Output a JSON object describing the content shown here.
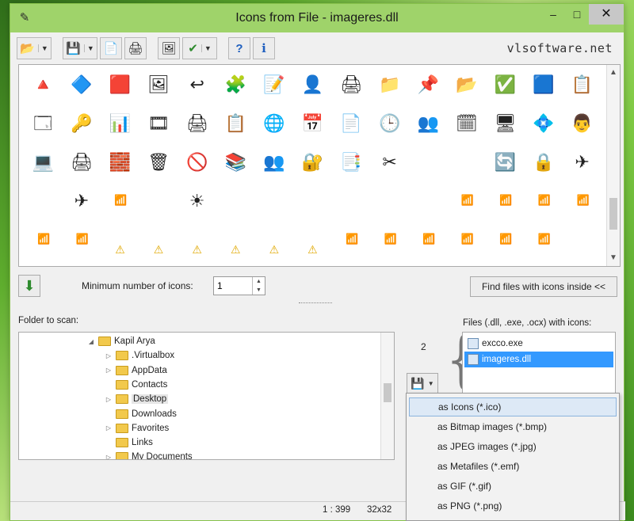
{
  "window": {
    "title": "Icons from File - imageres.dll",
    "app_icon": "pencil-icon",
    "controls": {
      "minimize": "–",
      "maximize": "□",
      "close": "✕"
    }
  },
  "toolbar": {
    "brand": "vlsoftware.net",
    "buttons": [
      {
        "name": "open-folder-icon",
        "glyph": "📂",
        "dropdown": true
      },
      {
        "name": "save-disk-icon",
        "glyph": "💾",
        "dropdown": true
      },
      {
        "name": "copy-icon",
        "glyph": "📄"
      },
      {
        "name": "print-icon",
        "glyph": "🖨"
      },
      {
        "name": "image-preview-icon",
        "glyph": "🖼"
      },
      {
        "name": "select-checkmark-icon",
        "glyph": "✔",
        "dropdown": true
      },
      {
        "name": "help-icon",
        "glyph": "?"
      },
      {
        "name": "info-icon",
        "glyph": "i"
      }
    ]
  },
  "icon_grid": {
    "rows": [
      [
        "🔺",
        "🔷",
        "🟥",
        "🖼",
        "↩",
        "🧩",
        "📝",
        "👤",
        "🖨",
        "📁",
        "📌",
        "📂",
        "✅",
        "🟦",
        "📋"
      ],
      [
        "🗔",
        "🔑",
        "📊",
        "🎞",
        "🖨",
        "📋",
        "🌐",
        "📅",
        "📄",
        "🕒",
        "👥",
        "🗓",
        "🖥",
        "💠",
        "👨"
      ],
      [
        "💻",
        "🖨",
        "🧱",
        "🗑",
        "🚫",
        "📚",
        "👥",
        "🔐",
        "📑",
        "✂",
        "",
        "",
        "🔄",
        "🔒",
        "✈"
      ],
      [
        "",
        "✈",
        "📶",
        "",
        "☀",
        "",
        "",
        "",
        "",
        "",
        "",
        "📶",
        "📶",
        "📶",
        "📶"
      ],
      [
        "📶",
        "📶",
        "⚠",
        "⚠",
        "⚠",
        "⚠",
        "⚠",
        "⚠",
        "📶",
        "📶",
        "📶",
        "📶",
        "📶",
        "📶",
        ""
      ]
    ]
  },
  "controls": {
    "min_icons_label": "Minimum number of icons:",
    "min_icons_value": "1",
    "find_button": "Find files with icons inside <<"
  },
  "folder_panel": {
    "label": "Folder to scan:",
    "items": [
      {
        "label": "Kapil Arya",
        "expander": "◢",
        "indent": 0,
        "selected": false
      },
      {
        "label": ".Virtualbox",
        "expander": "▷",
        "indent": 1,
        "selected": false
      },
      {
        "label": "AppData",
        "expander": "▷",
        "indent": 1,
        "selected": false
      },
      {
        "label": "Contacts",
        "expander": "",
        "indent": 1,
        "selected": false
      },
      {
        "label": "Desktop",
        "expander": "▷",
        "indent": 1,
        "selected": true
      },
      {
        "label": "Downloads",
        "expander": "",
        "indent": 1,
        "selected": false
      },
      {
        "label": "Favorites",
        "expander": "▷",
        "indent": 1,
        "selected": false
      },
      {
        "label": "Links",
        "expander": "",
        "indent": 1,
        "selected": false
      },
      {
        "label": "My Documents",
        "expander": "▷",
        "indent": 1,
        "selected": false
      }
    ]
  },
  "files_panel": {
    "count": "2",
    "label": "Files (.dll, .exe, .ocx) with icons:",
    "items": [
      {
        "label": "excco.exe",
        "selected": false
      },
      {
        "label": "imageres.dll",
        "selected": true
      }
    ]
  },
  "save_menu": {
    "items": [
      "as Icons (*.ico)",
      "as Bitmap images (*.bmp)",
      "as JPEG images (*.jpg)",
      "as Metafiles (*.emf)",
      "as GIF (*.gif)",
      "as PNG (*.png)"
    ],
    "highlighted_index": 0
  },
  "status": {
    "position": "1 : 399",
    "size": "32x32"
  }
}
